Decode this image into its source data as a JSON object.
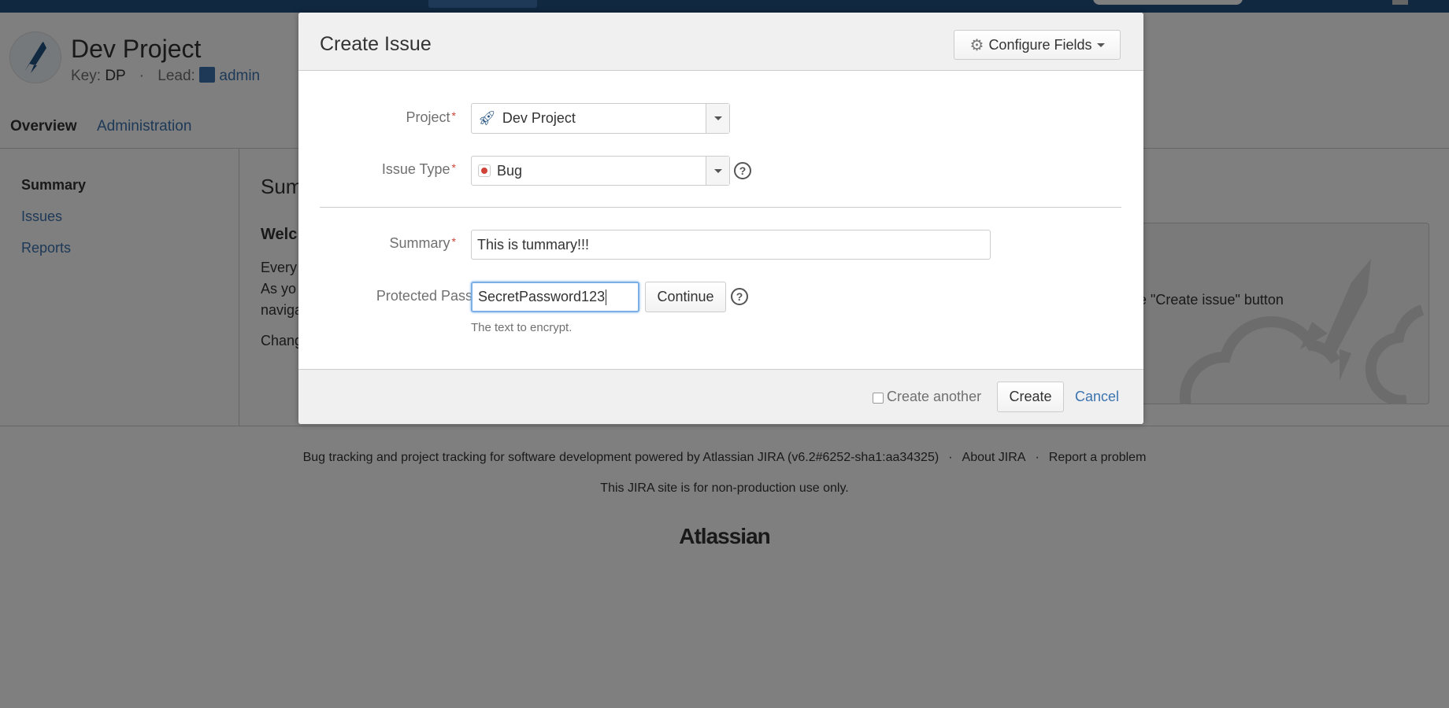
{
  "project": {
    "name": "Dev Project",
    "key_label": "Key:",
    "key": "DP",
    "lead_label": "Lead:",
    "lead": "admin"
  },
  "tabs": [
    {
      "label": "Overview"
    },
    {
      "label": "Administration"
    }
  ],
  "sidebar": {
    "items": [
      {
        "label": "Summary"
      },
      {
        "label": "Issues"
      },
      {
        "label": "Reports"
      }
    ]
  },
  "content": {
    "heading": "Sum",
    "welcome": "Welc",
    "lines": [
      "Every",
      "As yo",
      "naviga",
      "Chang"
    ],
    "panel_text": "e \"Create issue\" button"
  },
  "footer": {
    "powered": "Bug tracking and project tracking for software development powered by Atlassian JIRA (v6.2#6252-sha1:aa34325)",
    "about": "About JIRA",
    "report": "Report a problem",
    "notice": "This JIRA site is for non-production use only.",
    "logo": "Atlassian"
  },
  "dialog": {
    "title": "Create Issue",
    "configure_fields": "Configure Fields",
    "fields": {
      "project": {
        "label": "Project",
        "value": "Dev Project"
      },
      "issue_type": {
        "label": "Issue Type",
        "value": "Bug"
      },
      "summary": {
        "label": "Summary",
        "value": "This is tummary!!!"
      },
      "password": {
        "label": "Protected Password",
        "value": "SecretPassword123",
        "button": "Continue",
        "description": "The text to encrypt."
      }
    },
    "required_mark": "*",
    "help_glyph": "?",
    "create_another": "Create another",
    "create": "Create",
    "cancel": "Cancel"
  }
}
